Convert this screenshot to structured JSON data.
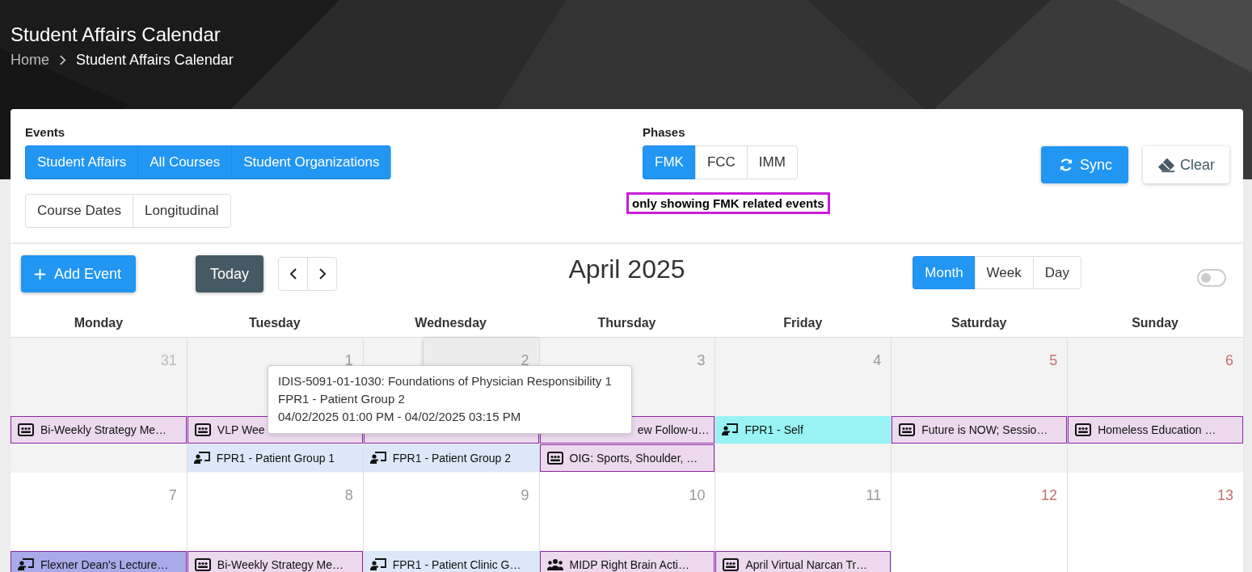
{
  "header": {
    "title": "Student Affairs Calendar",
    "breadcrumb": [
      {
        "label": "Home",
        "current": false
      },
      {
        "label": "Student Affairs Calendar",
        "current": true
      }
    ]
  },
  "events_filter": {
    "label": "Events",
    "groups": [
      [
        {
          "label": "Student Affairs",
          "selected": true
        },
        {
          "label": "All Courses",
          "selected": true
        },
        {
          "label": "Student Organizations",
          "selected": true
        }
      ],
      [
        {
          "label": "Course Dates",
          "selected": false
        },
        {
          "label": "Longitudinal",
          "selected": false
        }
      ]
    ]
  },
  "phases": {
    "label": "Phases",
    "options": [
      {
        "label": "FMK",
        "selected": true
      },
      {
        "label": "FCC",
        "selected": false
      },
      {
        "label": "IMM",
        "selected": false
      }
    ],
    "note": "only showing FMK related events"
  },
  "actions": [
    {
      "label": "Sync",
      "kind": "sync"
    },
    {
      "label": "Clear",
      "kind": "clear"
    }
  ],
  "calendar": {
    "add_button": "Add Event",
    "today_button": "Today",
    "title": "April 2025",
    "views": [
      {
        "label": "Month",
        "selected": true
      },
      {
        "label": "Week",
        "selected": false
      },
      {
        "label": "Day",
        "selected": false
      }
    ],
    "toggle": {
      "on": false
    },
    "weekdays": [
      "Monday",
      "Tuesday",
      "Wednesday",
      "Thursday",
      "Friday",
      "Saturday",
      "Sunday"
    ],
    "weeks": [
      {
        "days": [
          {
            "date": "31",
            "other_month": true,
            "weekend": false,
            "today": false,
            "past": true,
            "events": [
              {
                "kind": "meeting",
                "title": "Bi-Weekly Strategy Me…",
                "color": "#ecd9ee",
                "bordered": true
              }
            ]
          },
          {
            "date": "1",
            "other_month": false,
            "weekend": false,
            "today": false,
            "past": true,
            "events": [
              {
                "kind": "meeting",
                "title": "VLP Wee",
                "color": "#ecd9ee",
                "bordered": true
              },
              {
                "kind": "lecture",
                "title": "FPR1 - Patient Group 1",
                "color": "#dce8f9",
                "bordered": false
              }
            ]
          },
          {
            "date": "2",
            "other_month": false,
            "weekend": false,
            "today": true,
            "past": true,
            "events": [
              {
                "kind": "covered",
                "color": "#ecd9ee",
                "bordered": true
              },
              {
                "kind": "lecture",
                "title": "FPR1 - Patient Group 2",
                "color": "#dce8f9",
                "bordered": false
              }
            ]
          },
          {
            "date": "3",
            "other_month": false,
            "weekend": false,
            "today": false,
            "past": true,
            "events": [
              {
                "kind": "covered",
                "title": "ew Follow-u…",
                "color": "#ecd9ee",
                "bordered": true
              },
              {
                "kind": "meeting",
                "title": "OIG: Sports, Shoulder, …",
                "color": "#ecd9ee",
                "bordered": true
              }
            ]
          },
          {
            "date": "4",
            "other_month": false,
            "weekend": false,
            "today": false,
            "past": true,
            "events": [
              {
                "kind": "lecture",
                "title": "FPR1 - Self",
                "color": "#98f3f2",
                "bordered": false
              }
            ]
          },
          {
            "date": "5",
            "other_month": false,
            "weekend": true,
            "today": false,
            "past": true,
            "events": [
              {
                "kind": "meeting",
                "title": "Future is NOW; Sessio…",
                "color": "#ecd9ee",
                "bordered": true
              }
            ]
          },
          {
            "date": "6",
            "other_month": false,
            "weekend": true,
            "today": false,
            "past": true,
            "events": [
              {
                "kind": "meeting",
                "title": "Homeless Education …",
                "color": "#ecd9ee",
                "bordered": true
              }
            ]
          }
        ]
      },
      {
        "days": [
          {
            "date": "7",
            "other_month": false,
            "weekend": false,
            "today": false,
            "past": false,
            "events": [
              {
                "kind": "lecture",
                "title": "Flexner Dean's Lecture…",
                "color": "#a8aae9",
                "bordered": true
              }
            ]
          },
          {
            "date": "8",
            "other_month": false,
            "weekend": false,
            "today": false,
            "past": false,
            "events": [
              {
                "kind": "meeting",
                "title": "Bi-Weekly Strategy Me…",
                "color": "#ecd9ee",
                "bordered": true
              }
            ]
          },
          {
            "date": "9",
            "other_month": false,
            "weekend": false,
            "today": false,
            "past": false,
            "events": [
              {
                "kind": "lecture",
                "title": "FPR1 - Patient Clinic G…",
                "color": "#dce8f9",
                "bordered": false
              }
            ]
          },
          {
            "date": "10",
            "other_month": false,
            "weekend": false,
            "today": false,
            "past": false,
            "events": [
              {
                "kind": "group",
                "title": "MIDP Right Brain Acti…",
                "color": "#ecd9ee",
                "bordered": true
              }
            ]
          },
          {
            "date": "11",
            "other_month": false,
            "weekend": false,
            "today": false,
            "past": false,
            "events": [
              {
                "kind": "meeting",
                "title": "April Virtual Narcan Tr…",
                "color": "#ecd9ee",
                "bordered": true
              }
            ]
          },
          {
            "date": "12",
            "other_month": false,
            "weekend": true,
            "today": false,
            "past": false
          },
          {
            "date": "13",
            "other_month": false,
            "weekend": true,
            "today": false,
            "past": false
          }
        ]
      }
    ],
    "tooltip": {
      "lines": [
        "IDIS-5091-01-1030: Foundations of Physician Responsibility 1",
        "FPR1 - Patient Group 2",
        "04/02/2025 01:00 PM - 04/02/2025 03:15 PM"
      ]
    }
  }
}
